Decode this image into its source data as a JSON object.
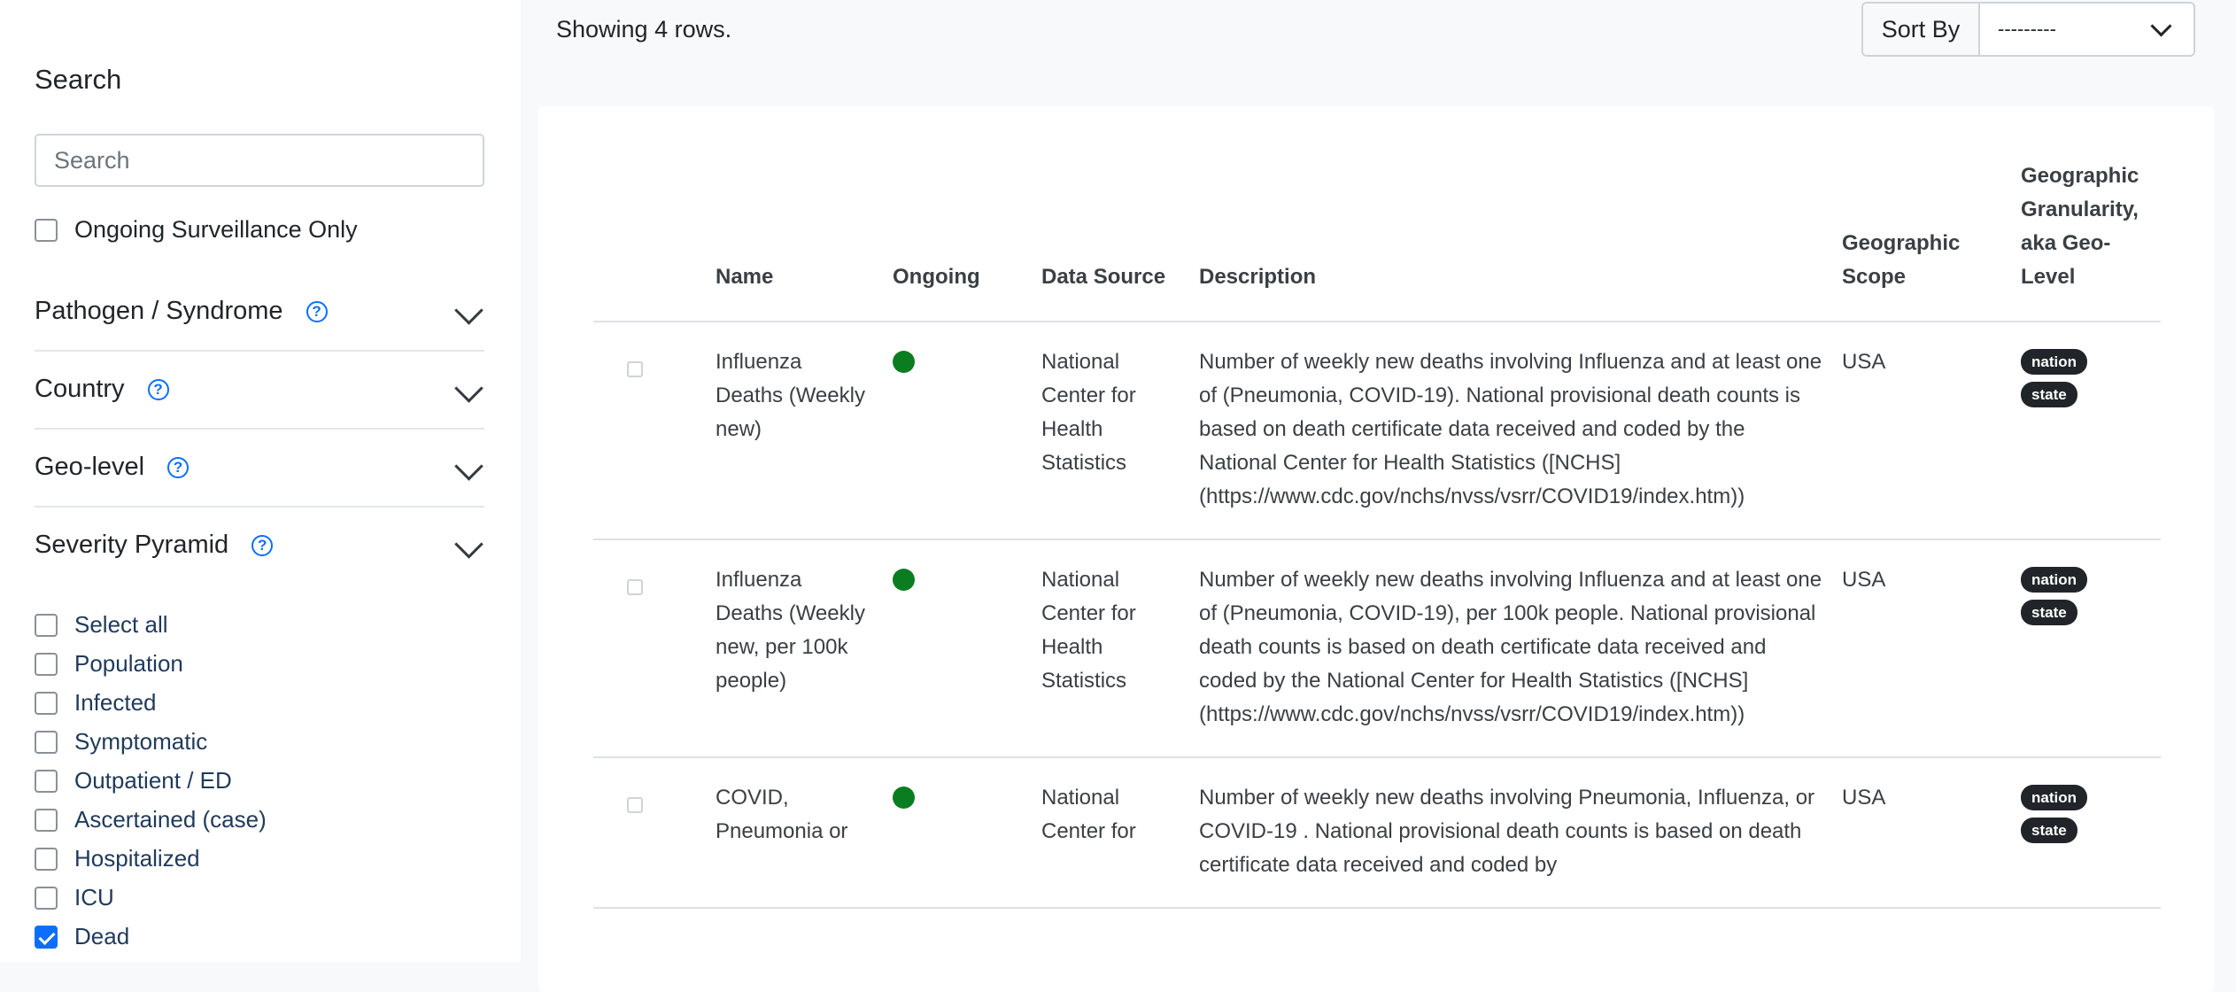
{
  "sidebar": {
    "heading": "Search",
    "search_placeholder": "Search",
    "ongoing_label": "Ongoing Surveillance Only",
    "sections": [
      {
        "label": "Pathogen / Syndrome"
      },
      {
        "label": "Country"
      },
      {
        "label": "Geo-level"
      },
      {
        "label": "Severity Pyramid"
      }
    ],
    "severity_items": [
      {
        "label": "Select all",
        "checked": false
      },
      {
        "label": "Population",
        "checked": false
      },
      {
        "label": "Infected",
        "checked": false
      },
      {
        "label": "Symptomatic",
        "checked": false
      },
      {
        "label": "Outpatient / ED",
        "checked": false
      },
      {
        "label": "Ascertained (case)",
        "checked": false
      },
      {
        "label": "Hospitalized",
        "checked": false
      },
      {
        "label": "ICU",
        "checked": false
      },
      {
        "label": "Dead",
        "checked": true
      }
    ]
  },
  "main": {
    "showing_text": "Showing 4 rows.",
    "sort_label": "Sort By",
    "sort_value": "---------",
    "columns": [
      "Name",
      "Ongoing",
      "Data Source",
      "Description",
      "Geographic Scope",
      "Geographic Granularity, aka Geo-Level"
    ],
    "rows": [
      {
        "name": "Influenza Deaths (Weekly new)",
        "ongoing": true,
        "source": "National Center for Health Statistics",
        "description": "Number of weekly new deaths involving Influenza and at least one of (Pneumonia, COVID-19). National provisional death counts is based on death certificate data received and coded by the National Center for Health Statistics ([NCHS](https://www.cdc.gov/nchs/nvss/vsrr/COVID19/index.htm))",
        "scope": "USA",
        "levels": [
          "nation",
          "state"
        ]
      },
      {
        "name": "Influenza Deaths (Weekly new, per 100k people)",
        "ongoing": true,
        "source": "National Center for Health Statistics",
        "description": "Number of weekly new deaths involving Influenza and at least one of (Pneumonia, COVID-19), per 100k people. National provisional death counts is based on death certificate data received and coded by the National Center for Health Statistics ([NCHS](https://www.cdc.gov/nchs/nvss/vsrr/COVID19/index.htm))",
        "scope": "USA",
        "levels": [
          "nation",
          "state"
        ]
      },
      {
        "name": "COVID, Pneumonia or",
        "ongoing": true,
        "source": "National Center for",
        "description": "Number of weekly new deaths involving Pneumonia, Influenza, or COVID-19 . National provisional death counts is based on death certificate data received and coded by",
        "scope": "USA",
        "levels": [
          "nation",
          "state"
        ]
      }
    ],
    "ongoing_color": "#0a7d21",
    "accent_color": "#0d6efd"
  }
}
